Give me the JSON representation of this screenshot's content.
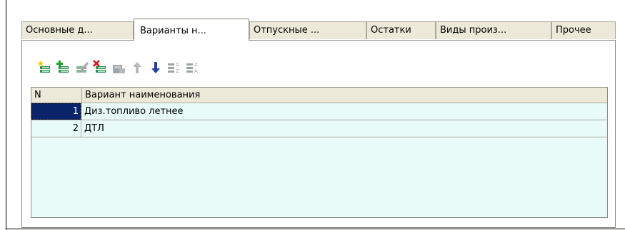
{
  "tabs": [
    {
      "label": "Основные д...",
      "active": false
    },
    {
      "label": "Варианты н...",
      "active": true
    },
    {
      "label": "Отпускные ...",
      "active": false
    },
    {
      "label": "Остатки",
      "active": false
    },
    {
      "label": "Виды произ...",
      "active": false
    },
    {
      "label": "Прочее",
      "active": false
    }
  ],
  "toolbar": {
    "buttons": [
      {
        "icon": "add-row-icon",
        "enabled": true
      },
      {
        "icon": "copy-row-icon",
        "enabled": true
      },
      {
        "icon": "edit-row-icon",
        "enabled": false
      },
      {
        "icon": "delete-row-icon",
        "enabled": true
      },
      {
        "icon": "end-edit-icon",
        "enabled": false
      },
      {
        "icon": "move-up-icon",
        "enabled": true
      },
      {
        "icon": "move-down-icon",
        "enabled": true
      },
      {
        "icon": "sort-ascending-icon",
        "enabled": false
      },
      {
        "icon": "sort-descending-icon",
        "enabled": false
      }
    ]
  },
  "table": {
    "columns": [
      "N",
      "Вариант наименования"
    ],
    "rows": [
      {
        "n": "1",
        "name": "Диз.топливо летнее",
        "selected": true
      },
      {
        "n": "2",
        "name": "ДТЛ",
        "selected": false
      }
    ]
  },
  "colors": {
    "grid_background": "#e8fbf8",
    "selection": "#0a246a",
    "tab_inactive": "#ece9d8"
  }
}
